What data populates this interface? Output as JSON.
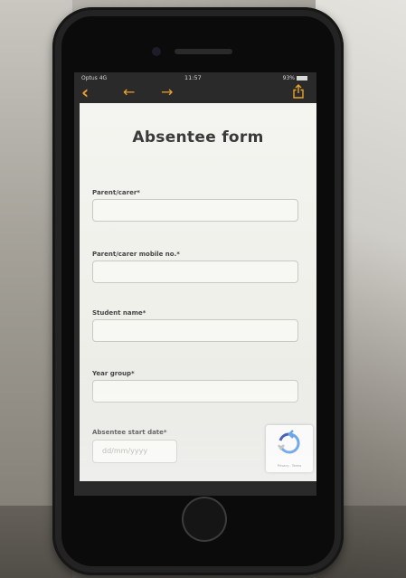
{
  "statusbar": {
    "carrier": "Optus 4G",
    "time": "11:57",
    "battery": "93%"
  },
  "navbar": {
    "back_icon": "chevron-left-icon",
    "prev_icon": "arrow-left-icon",
    "next_icon": "arrow-right-icon",
    "share_icon": "share-icon",
    "accent_color": "#e9a12a"
  },
  "form": {
    "title": "Absentee form",
    "fields": [
      {
        "label": "Parent/carer*",
        "value": ""
      },
      {
        "label": "Parent/carer mobile no.*",
        "value": ""
      },
      {
        "label": "Student name*",
        "value": ""
      },
      {
        "label": "Year group*",
        "value": ""
      },
      {
        "label": "Absentee start date*",
        "value": ""
      }
    ],
    "date_placeholder": "dd/mm/yyyy"
  },
  "recaptcha": {
    "icon": "recaptcha-icon",
    "links": "Privacy - Terms"
  }
}
